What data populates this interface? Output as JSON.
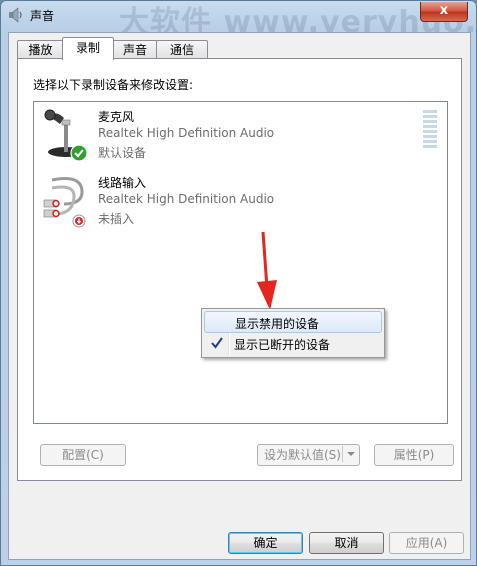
{
  "window": {
    "title": "声音",
    "watermark": "大软件 www.veryhuo.com",
    "close_label": "x"
  },
  "tabs": [
    {
      "label": "播放",
      "active": false
    },
    {
      "label": "录制",
      "active": true
    },
    {
      "label": "声音",
      "active": false
    },
    {
      "label": "通信",
      "active": false
    }
  ],
  "recording": {
    "instruction": "选择以下录制设备来修改设置:",
    "devices": [
      {
        "name": "麦克风",
        "driver": "Realtek High Definition Audio",
        "status": "默认设备",
        "icon": "microphone-icon",
        "badge": "default-checkmark-icon"
      },
      {
        "name": "线路输入",
        "driver": "Realtek High Definition Audio",
        "status": "未插入",
        "icon": "line-in-cable-icon",
        "badge": "unplugged-icon"
      }
    ]
  },
  "context_menu": {
    "items": [
      {
        "label": "显示禁用的设备",
        "checked": false
      },
      {
        "label": "显示已断开的设备",
        "checked": true
      }
    ]
  },
  "panel_buttons": {
    "configure": "配置(C)",
    "set_default": "设为默认值(S)",
    "properties": "属性(P)"
  },
  "dialog_buttons": {
    "ok": "确定",
    "cancel": "取消",
    "apply": "应用(A)"
  },
  "colors": {
    "accent_check": "#2ea12e",
    "annotation_arrow": "#e5261f",
    "menu_check": "#1f3a93"
  }
}
